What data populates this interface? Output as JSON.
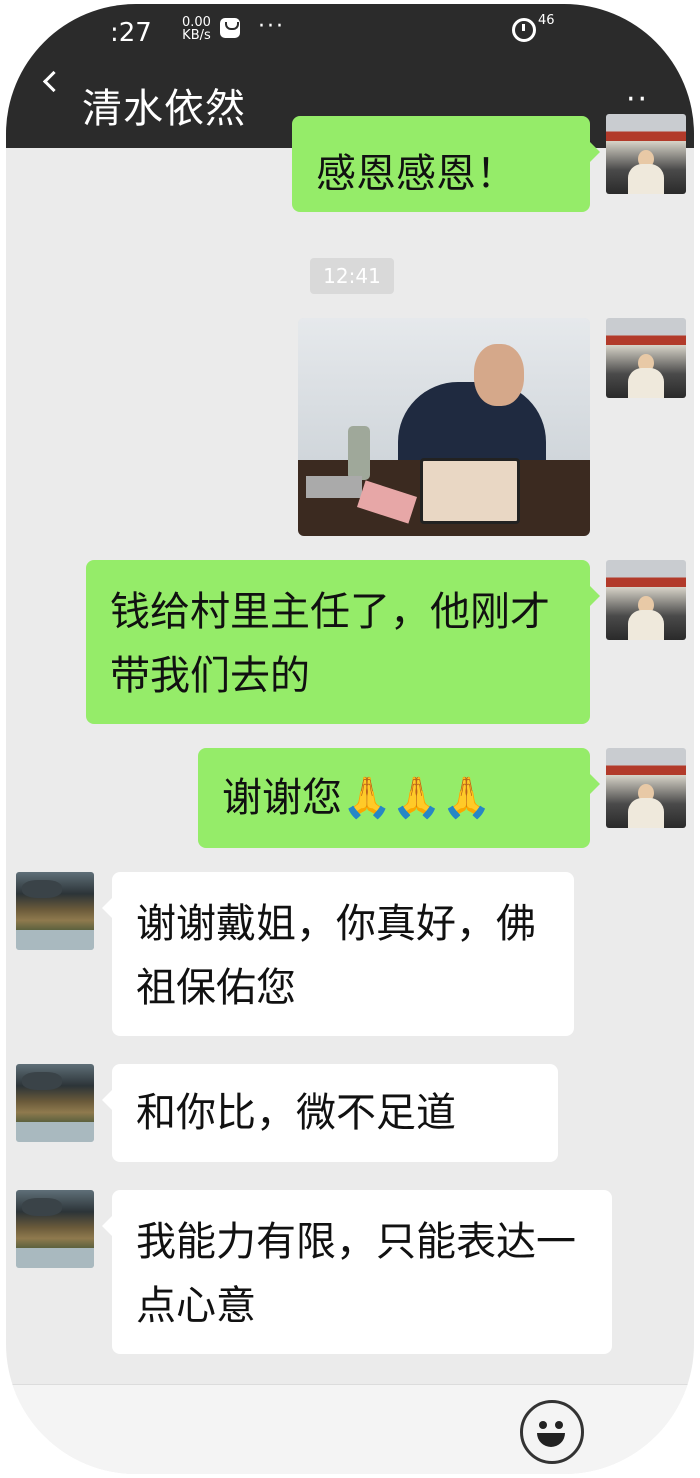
{
  "status_bar": {
    "time": ":27",
    "net_speed": "0.00",
    "net_unit": "KB/s",
    "overflow": "···",
    "signal": "46"
  },
  "header": {
    "title": "清水依然",
    "more": "··"
  },
  "messages": {
    "m1": "感恩感恩！",
    "time_sep": "12:41",
    "m2": "钱给村里主任了，他刚才带我们去的",
    "m3": "谢谢您🙏🙏🙏",
    "m4": "谢谢戴姐，你真好，佛祖保佑您",
    "m5": "和你比，微不足道",
    "m6": "我能力有限，只能表达一点心意"
  }
}
